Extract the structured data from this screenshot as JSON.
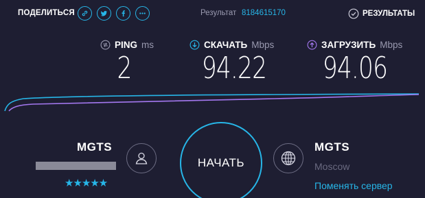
{
  "topbar": {
    "share_label": "ПОДЕЛИТЬСЯ",
    "share_buttons": [
      "link-icon",
      "twitter-icon",
      "facebook-icon",
      "more-icon"
    ],
    "result_label": "Результат",
    "result_id": "8184615170",
    "results_link": "РЕЗУЛЬТАТЫ"
  },
  "metrics": {
    "ping": {
      "name": "PING",
      "unit": "ms",
      "value": "2",
      "icon": "ping-icon",
      "color": "#9a9ab0"
    },
    "download": {
      "name": "СКАЧАТЬ",
      "unit": "Mbps",
      "value": "94.22",
      "icon": "download-arrow-icon",
      "color": "#27b6e8"
    },
    "upload": {
      "name": "ЗАГРУЗИТЬ",
      "unit": "Mbps",
      "value": "94.06",
      "icon": "upload-arrow-icon",
      "color": "#a478f0"
    }
  },
  "isp": {
    "name": "MGTS",
    "rating": "★★★★★",
    "icon": "user-icon"
  },
  "go_button": {
    "label": "НАЧАТЬ"
  },
  "server": {
    "name": "MGTS",
    "city": "Moscow",
    "change_label": "Поменять сервер",
    "icon": "globe-icon"
  },
  "colors": {
    "background": "#1e1e32",
    "accent": "#27b6e8",
    "upload": "#a478f0",
    "muted": "#9a9ab0"
  }
}
